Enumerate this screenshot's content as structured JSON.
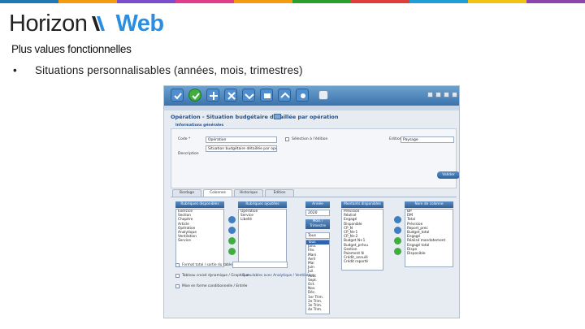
{
  "brand": {
    "name_part1": "Horizon",
    "name_part2": "Web",
    "stripe_colors": [
      "#1f77b4",
      "#f39c12",
      "#7c4dcc",
      "#e03c8a",
      "#f39c12",
      "#2ca02c",
      "#e03c3c",
      "#1f9fd6",
      "#f1c40f",
      "#8e44ad"
    ]
  },
  "slide": {
    "heading": "Plus values fonctionnelles",
    "bullet_symbol": "•",
    "bullet_text": "Situations personnalisables (années, mois, trimestres)"
  },
  "app": {
    "title": "Opération - Situation budgétaire détaillée par opération",
    "section": "Informations générales",
    "fields": {
      "code_label": "Code *",
      "code_value": "Opération",
      "edition_label": "Edition",
      "edition_value": "Paysage",
      "desc_label": "Description",
      "desc_value": "Situation budgétaire détaillée par opération",
      "checkbox_label": "Sélection à l'édition"
    },
    "go_button": "Valider",
    "tabs": [
      "Bordage",
      "Colonnes",
      "Historique",
      "Edition"
    ],
    "columns": {
      "rubriques_disponibles": {
        "header": "Rubriques disponibles",
        "items": [
          "Exercice",
          "Section",
          "Chapitre",
          "Article",
          "Opération",
          "Analytique",
          "Ventilation",
          "Service"
        ]
      },
      "rubriques_ajoutees": {
        "header": "Rubriques ajoutées",
        "items": [
          "Opération",
          "Service",
          "Libellé"
        ]
      },
      "annee": {
        "header": "Année",
        "year_value": "2020",
        "period_button": "Mois / Trimestre",
        "period_select": "Tous",
        "period_items": [
          "Tous",
          "Janv.",
          "Fév.",
          "Mars",
          "Avril",
          "Mai",
          "Juin",
          "Juil.",
          "Août",
          "Sept.",
          "Oct.",
          "Nov.",
          "Déc.",
          "1er Trim.",
          "2e Trim.",
          "3e Trim.",
          "4e Trim."
        ]
      },
      "montants_disponibles": {
        "header": "Montants disponibles",
        "items": [
          "Prévision",
          "Réalisé",
          "Engagé",
          "Disponible",
          "CP_N",
          "CP_N+1",
          "CP_N+2",
          "Budget N+1",
          "Budget_prévu",
          "Gestion",
          "Paiement N",
          "Crédit_annulé",
          "Crédit reporté"
        ]
      },
      "nom_colonne": {
        "header": "Nom de colonne",
        "items": [
          "BP",
          "DM",
          "Total",
          "Prévision",
          "Report_prec",
          "Budget_total",
          "Engagé",
          "Réalisé mandatement",
          "Engagé total",
          "Dispo",
          "Disponible"
        ]
      }
    },
    "bottom_options": [
      "Format total / sortie du tableau",
      "Tableau croisé dynamique / Graphique",
      "Mise en forme conditionnelle / Entrée"
    ],
    "bottom_hint": "Cumulables avec Analytique / Ventilation",
    "colors": {
      "toolbar_top": "#6da2cf",
      "toolbar_bottom": "#3a73ac",
      "column_header": "#2f5f96",
      "selected_item": "#2e63b3"
    },
    "toolbar_icons": [
      "check-icon",
      "edit-icon",
      "add-icon",
      "delete-icon",
      "refresh-icon",
      "print-icon",
      "export-icon",
      "help-icon"
    ]
  }
}
